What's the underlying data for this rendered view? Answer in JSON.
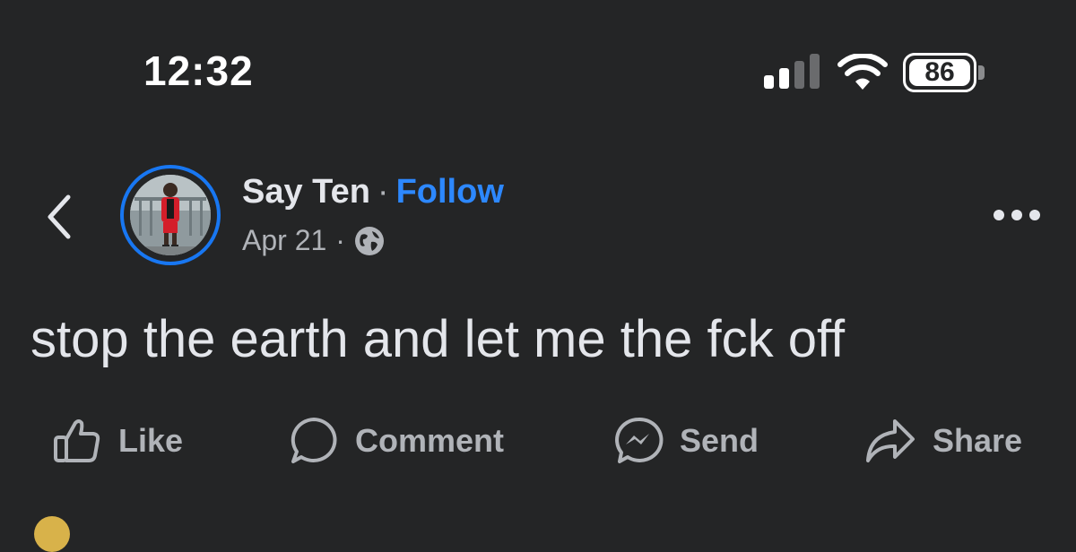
{
  "status_bar": {
    "time": "12:32",
    "battery": "86",
    "icons": [
      "cellular-signal-icon",
      "wifi-icon",
      "battery-icon"
    ]
  },
  "post": {
    "author": "Say Ten",
    "separator": "·",
    "follow_label": "Follow",
    "date": "Apr 21",
    "privacy_icon": "globe-icon",
    "text": "stop the earth and let me the fck off"
  },
  "actions": {
    "like": "Like",
    "comment": "Comment",
    "send": "Send",
    "share": "Share"
  },
  "colors": {
    "background": "#242526",
    "accent": "#2d88ff",
    "text": "#e4e6eb",
    "secondary": "#b0b3b8"
  }
}
